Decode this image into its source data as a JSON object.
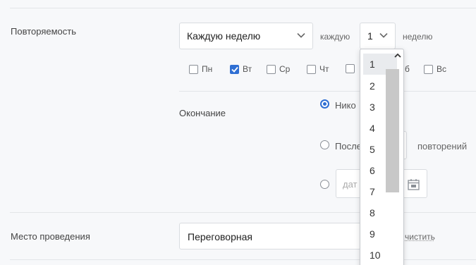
{
  "repeat": {
    "label": "Повторяемость",
    "frequency_value": "Каждую неделю",
    "every_label": "каждую",
    "interval_value": "1",
    "unit_label": "неделю"
  },
  "weekdays": [
    {
      "label": "Пн",
      "checked": false
    },
    {
      "label": "Вт",
      "checked": true
    },
    {
      "label": "Ср",
      "checked": false
    },
    {
      "label": "Чт",
      "checked": false
    },
    {
      "label": "",
      "checked": false
    },
    {
      "label": "б",
      "checked": false
    },
    {
      "label": "Вс",
      "checked": false
    }
  ],
  "ending": {
    "label": "Окончание",
    "option_never": "Нико",
    "option_after": "После",
    "repetitions_label": "повторений",
    "date_placeholder": "дат"
  },
  "location": {
    "label": "Место проведения",
    "value": "Переговорная",
    "clear_label": "чистить"
  },
  "dropdown": {
    "selected": "1",
    "options": [
      "1",
      "2",
      "3",
      "4",
      "5",
      "6",
      "7",
      "8",
      "9",
      "10"
    ]
  },
  "colors": {
    "accent": "#2f6fd3",
    "background": "#f7f8fa",
    "border": "#d9dce0"
  }
}
